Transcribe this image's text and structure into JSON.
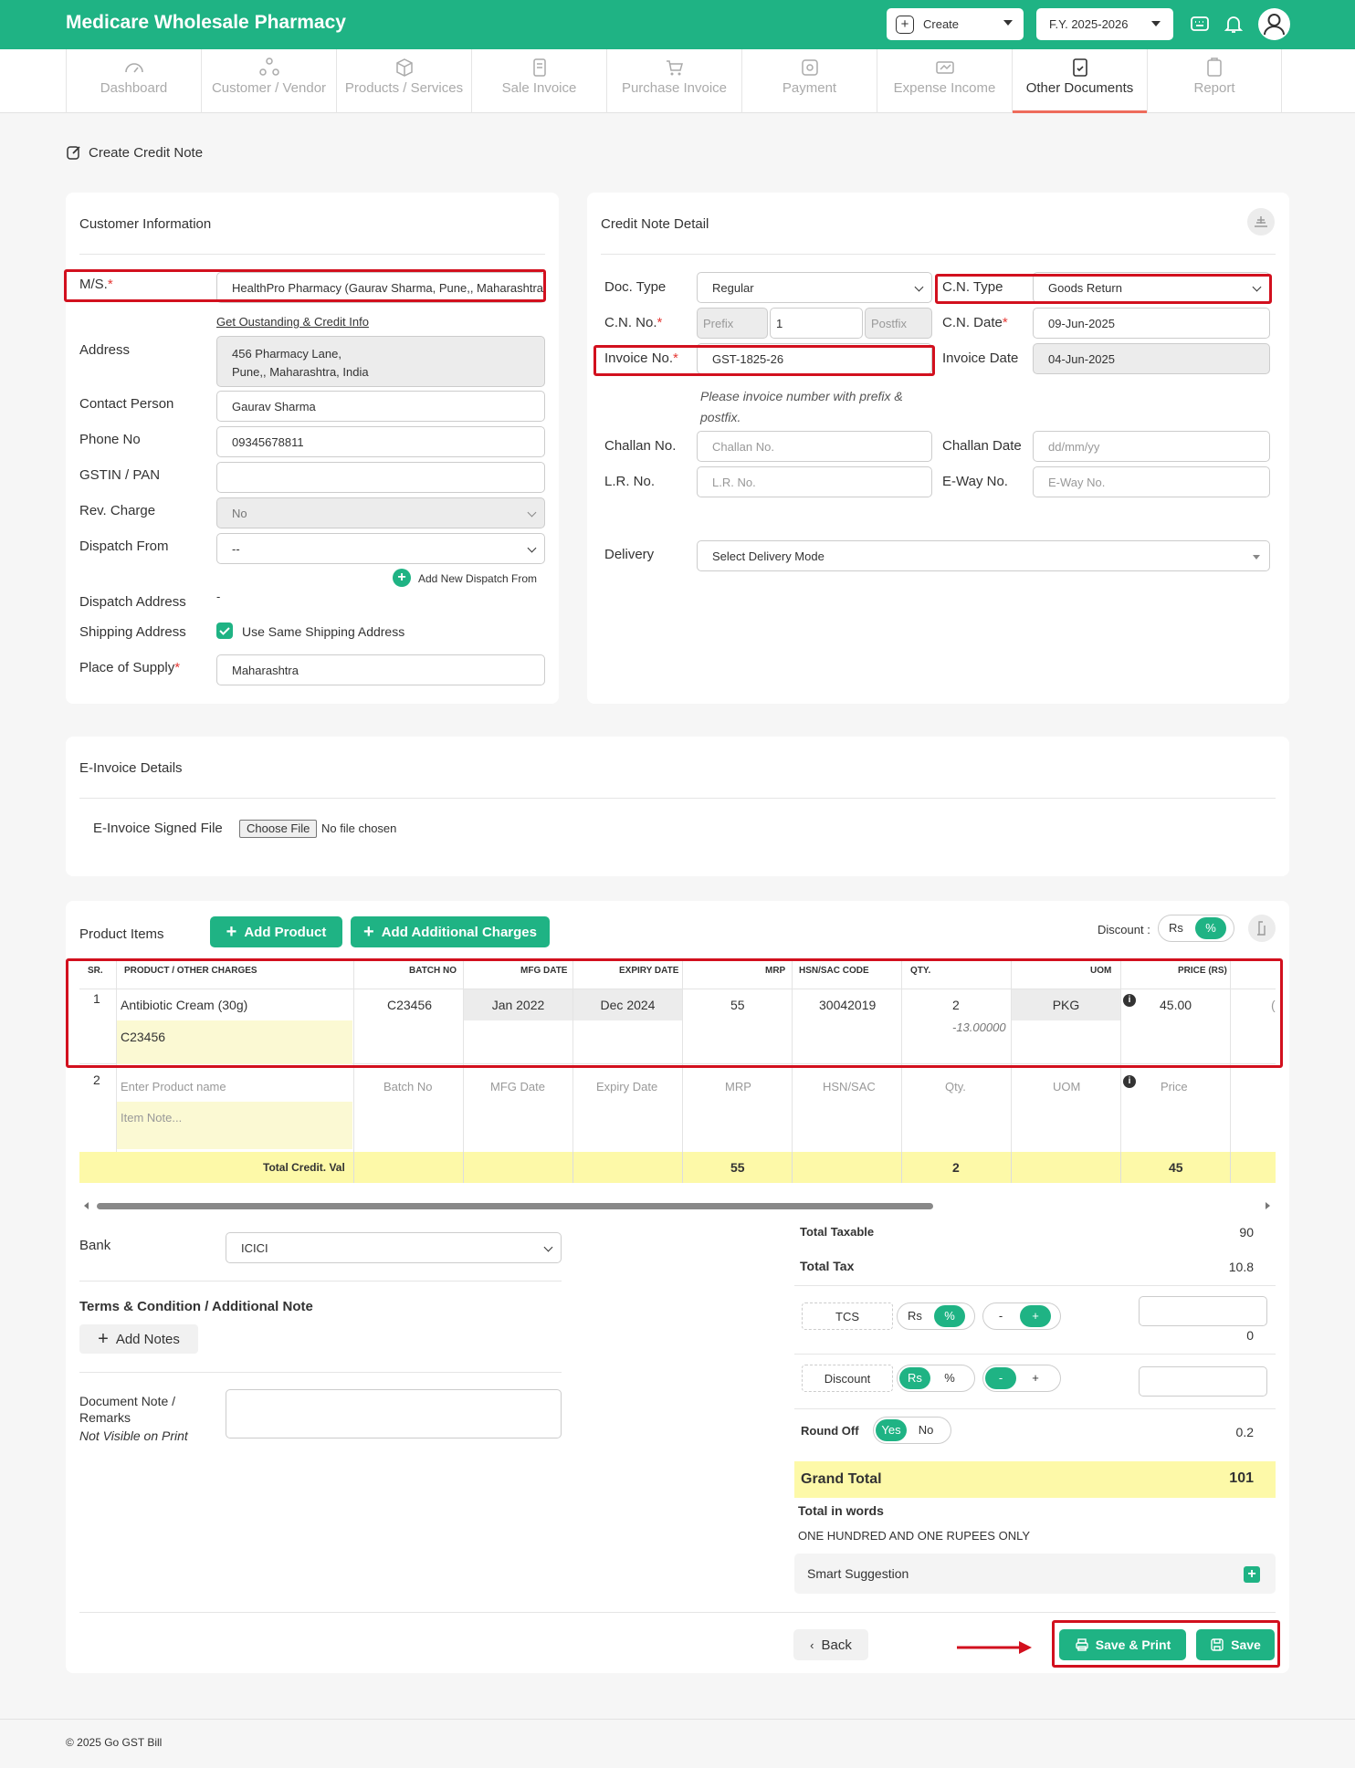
{
  "app": {
    "title": "Medicare Wholesale Pharmacy",
    "create_label": "Create",
    "fy_label": "F.Y. 2025-2026"
  },
  "nav": {
    "items": [
      {
        "label": "Dashboard"
      },
      {
        "label": "Customer / Vendor"
      },
      {
        "label": "Products / Services"
      },
      {
        "label": "Sale Invoice"
      },
      {
        "label": "Purchase Invoice"
      },
      {
        "label": "Payment"
      },
      {
        "label": "Expense Income"
      },
      {
        "label": "Other Documents"
      },
      {
        "label": "Report"
      }
    ]
  },
  "page": {
    "title": "Create Credit Note"
  },
  "customer": {
    "heading": "Customer Information",
    "ms_label": "M/S.",
    "ms_value": "HealthPro Pharmacy (Gaurav Sharma, Pune,, Maharashtra)",
    "outstanding_link": "Get Oustanding & Credit Info",
    "address_label": "Address",
    "address_line1": "456 Pharmacy Lane,",
    "address_line2": "Pune,, Maharashtra, India",
    "contact_label": "Contact Person",
    "contact_value": "Gaurav Sharma",
    "phone_label": "Phone No",
    "phone_value": "09345678811",
    "gstin_label": "GSTIN / PAN",
    "gstin_value": "",
    "rev_label": "Rev. Charge",
    "rev_value": "No",
    "dispatch_from_label": "Dispatch From",
    "dispatch_from_value": "--",
    "add_dispatch_label": "Add New Dispatch From",
    "dispatch_addr_label": "Dispatch Address",
    "dispatch_addr_value": "-",
    "shipping_label": "Shipping Address",
    "same_shipping_label": "Use Same Shipping Address",
    "pos_label": "Place of Supply",
    "pos_value": "Maharashtra"
  },
  "credit": {
    "heading": "Credit Note Detail",
    "doctype_label": "Doc. Type",
    "doctype_value": "Regular",
    "cntype_label": "C.N. Type",
    "cntype_value": "Goods Return",
    "cnno_label": "C.N. No.",
    "prefix_ph": "Prefix",
    "cnno_value": "1",
    "postfix_ph": "Postfix",
    "cndate_label": "C.N. Date",
    "cndate_value": "09-Jun-2025",
    "invno_label": "Invoice No.",
    "invno_value": "GST-1825-26",
    "invdate_label": "Invoice Date",
    "invdate_value": "04-Jun-2025",
    "hint_line1": "Please invoice number with prefix &",
    "hint_line2": "postfix.",
    "challan_label": "Challan No.",
    "challan_ph": "Challan No.",
    "challan_date_label": "Challan Date",
    "challan_date_ph": "dd/mm/yy",
    "lr_label": "L.R. No.",
    "lr_ph": "L.R. No.",
    "eway_label": "E-Way No.",
    "eway_ph": "E-Way No.",
    "delivery_label": "Delivery",
    "delivery_value": "Select Delivery Mode"
  },
  "einvoice": {
    "heading": "E-Invoice Details",
    "file_label": "E-Invoice Signed File",
    "choose_label": "Choose File",
    "no_file": "No file chosen"
  },
  "products": {
    "heading": "Product Items",
    "add_product": "Add Product",
    "add_charges": "Add Additional Charges",
    "discount_label": "Discount :",
    "disc_rs": "Rs",
    "disc_pct": "%",
    "columns": [
      "SR.",
      "PRODUCT / OTHER CHARGES",
      "BATCH NO",
      "MFG DATE",
      "EXPIRY DATE",
      "MRP",
      "HSN/SAC CODE",
      "QTY.",
      "UOM",
      "PRICE (RS)"
    ],
    "row1": {
      "sr": "1",
      "name": "Antibiotic Cream (30g)",
      "note": "C23456",
      "batch": "C23456",
      "mfg": "Jan 2022",
      "exp": "Dec 2024",
      "mrp": "55",
      "hsn": "30042019",
      "qty": "2",
      "qty_sub": "-13.00000",
      "uom": "PKG",
      "price": "45.00",
      "trail": "("
    },
    "row2": {
      "sr": "2",
      "name_ph": "Enter Product name",
      "note_ph": "Item Note...",
      "batch": "Batch No",
      "mfg": "MFG Date",
      "exp": "Expiry Date",
      "mrp": "MRP",
      "hsn": "HSN/SAC",
      "qty": "Qty.",
      "uom": "UOM",
      "price": "Price"
    },
    "total": {
      "label": "Total Credit. Val",
      "mrp": "55",
      "qty": "2",
      "price": "45"
    }
  },
  "bottom": {
    "bank_label": "Bank",
    "bank_value": "ICICI",
    "terms_label": "Terms & Condition / Additional Note",
    "add_notes": "Add Notes",
    "doc_note_line1": "Document Note /",
    "doc_note_line2": "Remarks",
    "not_visible": "Not Visible on Print"
  },
  "totals": {
    "taxable_label": "Total Taxable",
    "taxable_value": "90",
    "tax_label": "Total Tax",
    "tax_value": "10.8",
    "tcs_label": "TCS",
    "tcs_value": "0",
    "discount_label": "Discount",
    "rs": "Rs",
    "pct": "%",
    "minus": "-",
    "plus": "+",
    "roundoff_label": "Round Off",
    "yes": "Yes",
    "no": "No",
    "roundoff_value": "0.2",
    "grand_label": "Grand Total",
    "grand_value": "101",
    "words_label": "Total in words",
    "words_value": "ONE HUNDRED AND ONE RUPEES ONLY",
    "smart_label": "Smart Suggestion"
  },
  "actions": {
    "back": "Back",
    "save_print": "Save & Print",
    "save": "Save"
  },
  "footer": {
    "text": "© 2025 Go GST Bill"
  },
  "colors": {
    "brand": "#1fb384",
    "highlight": "#d2101e",
    "total_row": "#fdf9a8"
  }
}
